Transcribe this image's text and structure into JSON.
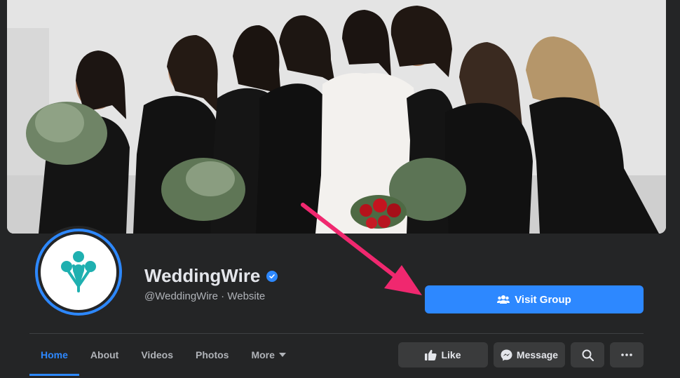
{
  "page": {
    "name": "WeddingWire",
    "handle": "@WeddingWire",
    "separator": "·",
    "category": "Website",
    "verified": true
  },
  "cover": {
    "people_count": 8
  },
  "buttons": {
    "visit_group": "Visit Group",
    "like": "Like",
    "message": "Message"
  },
  "tabs": [
    {
      "label": "Home",
      "active": true
    },
    {
      "label": "About",
      "active": false
    },
    {
      "label": "Videos",
      "active": false
    },
    {
      "label": "Photos",
      "active": false
    },
    {
      "label": "More",
      "active": false
    }
  ],
  "colors": {
    "background": "#242526",
    "accent": "#2d88ff",
    "annotation_arrow": "#f0286f",
    "logo_teal": "#1fb0b0"
  }
}
